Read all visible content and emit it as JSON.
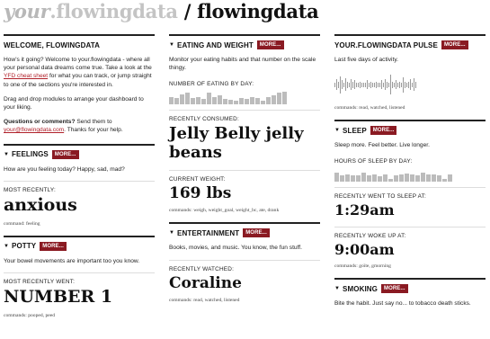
{
  "header": {
    "part_italic": "your",
    "part_light": ".flowingdata",
    "separator": " / ",
    "part_main": "flowingdata"
  },
  "welcome": {
    "title": "WELCOME, FLOWINGDATA",
    "p1_a": "How's it going? Welcome to your.flowingdata - where all your personal data dreams come true. Take a look at the ",
    "p1_link": "YFD cheat sheet",
    "p1_b": " for what you can track, or jump straight to one of the sections you're interested in.",
    "p2": "Drag and drop modules to arrange your dashboard to your liking.",
    "p3_bold": "Questions or comments?",
    "p3_a": " Send them to ",
    "p3_link": "your@flowingdata.com",
    "p3_b": ". Thanks for your help."
  },
  "feelings": {
    "title": "FEELINGS",
    "more": "MORE...",
    "desc": "How are you feeling today? Happy, sad, mad?",
    "recent_label": "MOST RECENTLY:",
    "recent_value": "anxious",
    "commands": "command: feeling"
  },
  "potty": {
    "title": "POTTY",
    "more": "MORE...",
    "desc": "Your bowel movements are important too you know.",
    "recent_label": "MOST RECENTLY WENT:",
    "recent_value": "NUMBER 1",
    "commands": "commands: pooped, peed"
  },
  "eating": {
    "title": "EATING AND WEIGHT",
    "more": "MORE...",
    "desc": "Monitor your eating habits and that number on the scale thingy.",
    "chart_label": "NUMBER OF EATING BY DAY:",
    "bars": [
      0.6,
      0.5,
      0.8,
      0.9,
      0.5,
      0.6,
      0.45,
      0.9,
      0.55,
      0.7,
      0.4,
      0.35,
      0.3,
      0.5,
      0.45,
      0.55,
      0.5,
      0.3,
      0.6,
      0.7,
      0.9,
      1.0
    ],
    "consumed_label": "RECENTLY CONSUMED:",
    "consumed_value": "Jelly Belly jelly beans",
    "weight_label": "CURRENT WEIGHT:",
    "weight_value": "169 lbs",
    "commands": "commands: weigh, weight_goal, weight_bc, ate, drank"
  },
  "entertainment": {
    "title": "ENTERTAINMENT",
    "more": "MORE...",
    "desc": "Books, movies, and music. You know, the fun stuff.",
    "recent_label": "RECENTLY WATCHED:",
    "recent_value": "Coraline",
    "commands": "commands: read, watched, listened"
  },
  "pulse": {
    "title": "YOUR.FLOWINGDATA PULSE",
    "more": "MORE...",
    "desc": "Last five days of activity.",
    "lines": [
      0.2,
      0.5,
      0.3,
      0.8,
      0.4,
      0.2,
      0.6,
      0.3,
      0.2,
      0.5,
      0.3,
      0.4,
      0.2,
      0.2,
      0.3,
      0.2,
      0.2,
      0.2,
      0.4,
      0.2,
      0.3,
      0.2,
      0.2,
      0.3,
      0.2,
      0.2,
      0.4,
      0.2,
      0.5,
      0.3,
      0.2,
      0.9,
      0.3,
      0.2,
      0.4,
      0.2,
      0.3,
      0.2,
      0.7,
      0.3,
      0.2,
      0.3,
      0.5,
      0.2,
      0.6,
      0.3
    ],
    "commands": "commands: read, watched, listened"
  },
  "sleep": {
    "title": "SLEEP",
    "more": "MORE...",
    "desc": "Sleep more. Feel better. Live longer.",
    "chart_label": "HOURS OF SLEEP BY DAY:",
    "bars": [
      0.7,
      0.5,
      0.6,
      0.5,
      0.5,
      0.7,
      0.5,
      0.55,
      0.45,
      0.6,
      0.2,
      0.5,
      0.6,
      0.65,
      0.55,
      0.5,
      0.7,
      0.6,
      0.55,
      0.5,
      0.2,
      0.6
    ],
    "went_label": "RECENTLY WENT TO SLEEP AT:",
    "went_value": "1:29am",
    "woke_label": "RECENTLY WOKE UP AT:",
    "woke_value": "9:00am",
    "commands": "commands: goïte, gmorning"
  },
  "smoking": {
    "title": "SMOKING",
    "more": "MORE...",
    "desc": "Bite the habit. Just say no... to tobacco death sticks."
  }
}
